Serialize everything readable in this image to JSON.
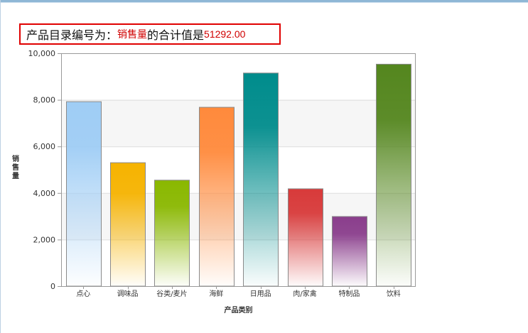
{
  "header": {
    "prefix": "产品目录编号为：",
    "field": "销售量",
    "middle": "的合计值是",
    "total": "51292.00"
  },
  "chart_data": {
    "type": "bar",
    "categories": [
      "点心",
      "调味品",
      "谷类/麦片",
      "海鲜",
      "日用品",
      "肉/家禽",
      "特制品",
      "饮料"
    ],
    "values": [
      7920,
      5300,
      4550,
      7680,
      9150,
      4180,
      2990,
      9530
    ],
    "colors": [
      "#9fcdf5",
      "#f6b300",
      "#8ab800",
      "#ff8a3c",
      "#008c8c",
      "#d83a3a",
      "#8a3e8c",
      "#54861e"
    ],
    "xlabel": "产品类别",
    "ylabel": "销售量",
    "ylim": [
      0,
      10000
    ],
    "yticks": [
      0,
      2000,
      4000,
      6000,
      8000,
      10000
    ],
    "ytick_labels": [
      "0",
      "2,000",
      "4,000",
      "6,000",
      "8,000",
      "10,000"
    ],
    "grid": true,
    "legend": "none"
  }
}
